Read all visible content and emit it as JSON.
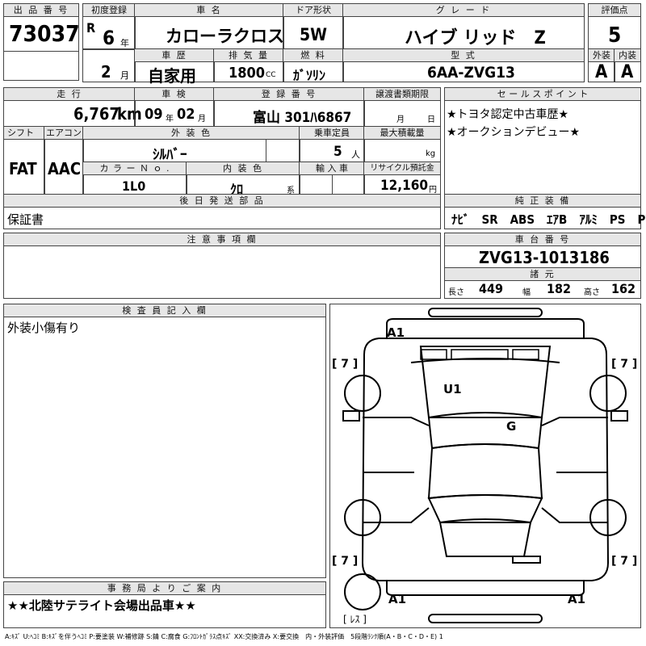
{
  "headers": {
    "lot_no": "出 品 番 号",
    "first_reg": "初度登録",
    "car_name": "車 名",
    "door": "ドア形状",
    "grade": "グ レ ー ド",
    "score": "評価点",
    "history": "車 歴",
    "displacement": "排 気 量",
    "fuel": "燃 料",
    "model": "型 式",
    "exterior": "外装",
    "interior": "内装",
    "mileage": "走 行",
    "inspection": "車 検",
    "reg_no": "登 録 番 号",
    "transfer": "譲渡書類期限",
    "sales_point": "セ ー ル ス ポ イ ン ト",
    "shift": "シフト",
    "aircon": "エアコン",
    "color": "外 装 色",
    "capacity": "乗車定員",
    "max_load": "最大積載量",
    "color_no": "カ ラ ー Ｎ ｏ .",
    "int_color": "内 装 色",
    "import": "輸 入 車",
    "recycle": "リサイクル預託金",
    "later_parts": "後 日 発 送 部 品",
    "genuine": "純 正 装 備",
    "notes": "注 意 事 項 欄",
    "chassis": "車 台 番 号",
    "specs": "諸 元",
    "inspector": "検 査 員 記 入 欄",
    "office": "事 務 局 よ り ご 案 内"
  },
  "lot_no": "73037",
  "era": "R",
  "year": "6",
  "year_unit": "年",
  "month": "2",
  "month_unit": "月",
  "car_name": "カローラクロス",
  "door": "5W",
  "grade": "ハイブ リッド　Z",
  "score": "5",
  "history": "自家用",
  "displacement": "1800",
  "displacement_unit": "CC",
  "fuel": "ｶﾞｿﾘﾝ",
  "model": "6AA-ZVG13",
  "exterior_grade": "A",
  "interior_grade": "A",
  "mileage": "6,767",
  "mileage_unit": "km",
  "insp_year": "09",
  "insp_month": "02",
  "reg_no": "富山 301ﾊ6867",
  "transfer_month": "月",
  "transfer_day": "日",
  "sales_points": [
    "★トヨタ認定中古車歴★",
    "★オークションデビュー★"
  ],
  "shift": "FAT",
  "aircon": "AAC",
  "color": "ｼﾙﾊﾞｰ",
  "capacity": "5",
  "capacity_unit": "人",
  "max_load_unit": "kg",
  "color_no": "1L0",
  "int_color": "ｸﾛ",
  "int_color_unit": "系",
  "recycle": "12,160",
  "recycle_unit": "円",
  "later_parts": "保証書",
  "genuine": "ﾅﾋﾞ　SR　ABS　ｴｱB　ｱﾙﾐ　PS　PW",
  "chassis": "ZVG13-1013186",
  "length_label": "長さ",
  "length": "449",
  "width_label": "幅",
  "width": "182",
  "height_label": "高さ",
  "height": "162",
  "inspector_note": "外装小傷有り",
  "office_note": "★★北陸サテライト会場出品車★★",
  "diagram": {
    "marks": {
      "a1_top": "A1",
      "u1": "U1",
      "g": "G",
      "a1_bl": "A1",
      "a1_br": "A1",
      "tl": "[ 7 ]",
      "tr": "[ 7 ]",
      "bl": "[ 7 ]",
      "br": "[ 7 ]",
      "less": "[ ﾚｽ ]"
    }
  },
  "legend": "A:ｷｽﾞ U:ﾍｺﾐ B:ｷｽﾞを伴うﾍｺﾐ P:要塗装 W:補修跡 S:錆 C:腐食 G:ﾌﾛﾝﾄｶﾞﾗｽ点ｷｽﾞ XX:交換済み X:要交換　内・外装評価　5段階ﾗﾝｸ順(A・B・C・D・E) 1"
}
